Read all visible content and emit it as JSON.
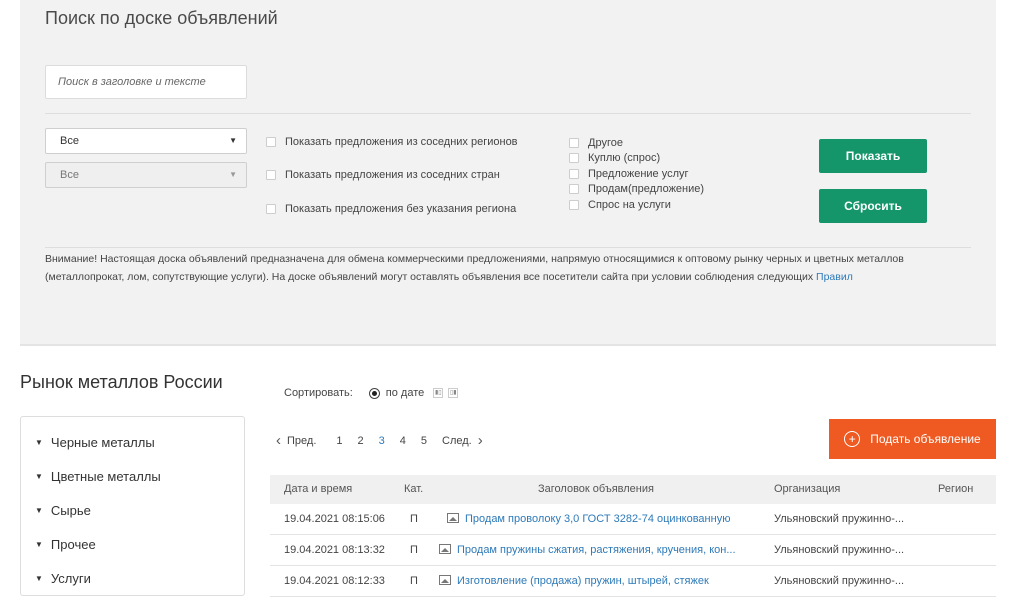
{
  "search": {
    "title": "Поиск по доске объявлений",
    "placeholder": "Поиск в заголовке и тексте",
    "select1": "Все",
    "select2": "Все",
    "region_checkboxes": [
      "Показать предложения из соседних регионов",
      "Показать предложения из соседних стран",
      "Показать предложения без указания региона"
    ],
    "type_checkboxes": [
      "Другое",
      "Куплю (спрос)",
      "Предложение услуг",
      "Продам(предложение)",
      "Спрос на услуги"
    ],
    "show_button": "Показать",
    "reset_button": "Сбросить",
    "notice_text": "Внимание! Настоящая доска объявлений предназначена для обмена коммерческими предложениями, напрямую относящимися к оптовому рынку черных и цветных металлов (металлопрокат, лом, сопутствующие услуги). На доске объявлений могут оставлять объявления все посетители сайта при условии соблюдения следующих",
    "notice_link": "Правил"
  },
  "market": {
    "title": "Рынок металлов России",
    "items": [
      "Черные металлы",
      "Цветные металлы",
      "Сырье",
      "Прочее",
      "Услуги"
    ]
  },
  "sort": {
    "label": "Сортировать:",
    "option": "по дате"
  },
  "pager": {
    "prev": "Пред.",
    "pages": [
      "1",
      "2",
      "3",
      "4",
      "5"
    ],
    "active": "3",
    "next": "След."
  },
  "add_button": "Подать объявление",
  "table": {
    "headers": [
      "Дата и время",
      "Кат.",
      "Заголовок объявления",
      "Организация",
      "Регион"
    ],
    "rows": [
      {
        "date": "19.04.2021 08:15:06",
        "cat": "П",
        "title": "Продам проволоку 3,0 ГОСТ 3282-74 оцинкованную",
        "org": "Ульяновский пружинно-..."
      },
      {
        "date": "19.04.2021 08:13:32",
        "cat": "П",
        "title": "Продам пружины сжатия, растяжения, кручения, кон...",
        "org": "Ульяновский пружинно-..."
      },
      {
        "date": "19.04.2021 08:12:33",
        "cat": "П",
        "title": "Изготовление (продажа) пружин, штырей, стяжек",
        "org": "Ульяновский пружинно-..."
      }
    ]
  }
}
